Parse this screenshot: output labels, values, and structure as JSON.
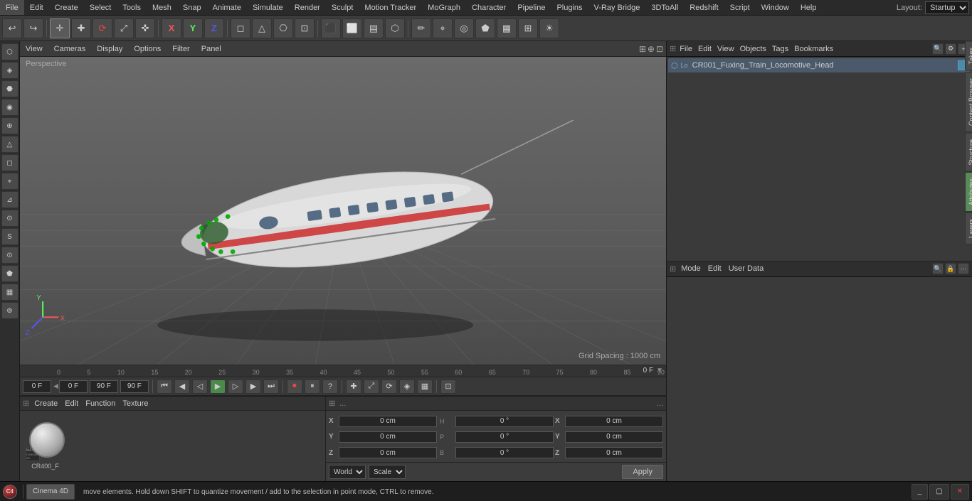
{
  "app": {
    "title": "Cinema 4D"
  },
  "menu": {
    "items": [
      "File",
      "Edit",
      "Create",
      "Select",
      "Tools",
      "Mesh",
      "Snap",
      "Animate",
      "Simulate",
      "Render",
      "Sculpt",
      "Motion Tracker",
      "MoGraph",
      "Character",
      "Pipeline",
      "Plugins",
      "V-Ray Bridge",
      "3DToAll",
      "Redshift",
      "Script",
      "Window",
      "Help"
    ]
  },
  "layout": {
    "label": "Layout:",
    "value": "Startup"
  },
  "viewport": {
    "mode": "Perspective",
    "grid_spacing": "Grid Spacing : 1000 cm"
  },
  "viewport_topbar": {
    "items": [
      "View",
      "Cameras",
      "Display",
      "Options",
      "Filter",
      "Panel"
    ]
  },
  "timeline": {
    "start_frame": "0 F",
    "current_frame": "0 F",
    "end_frame": "90 F",
    "preview_end": "90 F",
    "frame_right": "0 F",
    "ruler_marks": [
      "0",
      "5",
      "10",
      "15",
      "20",
      "25",
      "30",
      "35",
      "40",
      "45",
      "50",
      "55",
      "60",
      "65",
      "70",
      "75",
      "80",
      "85",
      "90"
    ]
  },
  "material_panel": {
    "menus": [
      "Create",
      "Edit",
      "Function",
      "Texture"
    ],
    "material_name": "CR400_F",
    "sphere_label": "CR400_F"
  },
  "properties": {
    "dots_left": "...",
    "dots_right": "...",
    "coords": {
      "x_pos": "0 cm",
      "y_pos": "0 cm",
      "z_pos": "0 cm",
      "x_size": "0 cm",
      "y_size": "0 cm",
      "z_size": "0 cm",
      "h_rot": "0 °",
      "p_rot": "0 °",
      "b_rot": "0 °"
    },
    "labels": {
      "x": "X",
      "y": "Y",
      "z": "Z",
      "h": "H",
      "p": "P",
      "b": "B",
      "x2": "X",
      "y2": "Y",
      "z2": "Z"
    },
    "world_dropdown": "World",
    "scale_dropdown": "Scale",
    "apply_button": "Apply"
  },
  "right_panel": {
    "top_menus": [
      "File",
      "Edit",
      "View",
      "Objects",
      "Tags",
      "Bookmarks"
    ],
    "object_name": "CR001_Fuxing_Train_Locomotive_Head",
    "bottom_menus": [
      "Mode",
      "Edit",
      "User Data"
    ],
    "tabs": [
      "Takes",
      "Content Browser",
      "Structure",
      "Attributes",
      "Layers"
    ]
  },
  "statusbar": {
    "message": "move elements. Hold down SHIFT to quantize movement / add to the selection in point mode, CTRL to remove."
  },
  "taskbar": {
    "cinema4d_label": "MAXON CINEMA 4D",
    "btn1_label": "▢",
    "btn2_label": "✕"
  }
}
